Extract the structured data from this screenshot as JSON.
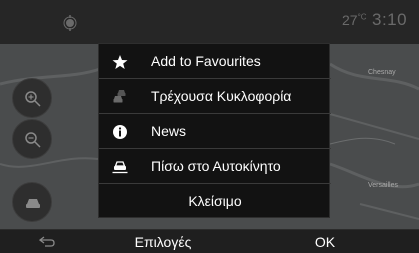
{
  "status": {
    "temperature": "27",
    "temperature_unit": "°C",
    "time": "3:10"
  },
  "map": {
    "labels": [
      "Chesnay",
      "Versailles"
    ]
  },
  "menu": {
    "items": [
      {
        "label": "Add to Favourites",
        "icon": "star-icon"
      },
      {
        "label": "Τρέχουσα Κυκλοφορία",
        "icon": "traffic-icon"
      },
      {
        "label": "News",
        "icon": "info-icon"
      },
      {
        "label": "Πίσω στο Αυτοκίνητο",
        "icon": "car-icon"
      }
    ],
    "close_label": "Κλείσιμο"
  },
  "bottombar": {
    "options_label": "Επιλογές",
    "ok_label": "OK"
  },
  "colors": {
    "background": "#1a1a1a",
    "map": "#4a4c4d",
    "menu": "#121212",
    "text": "#ffffff"
  }
}
